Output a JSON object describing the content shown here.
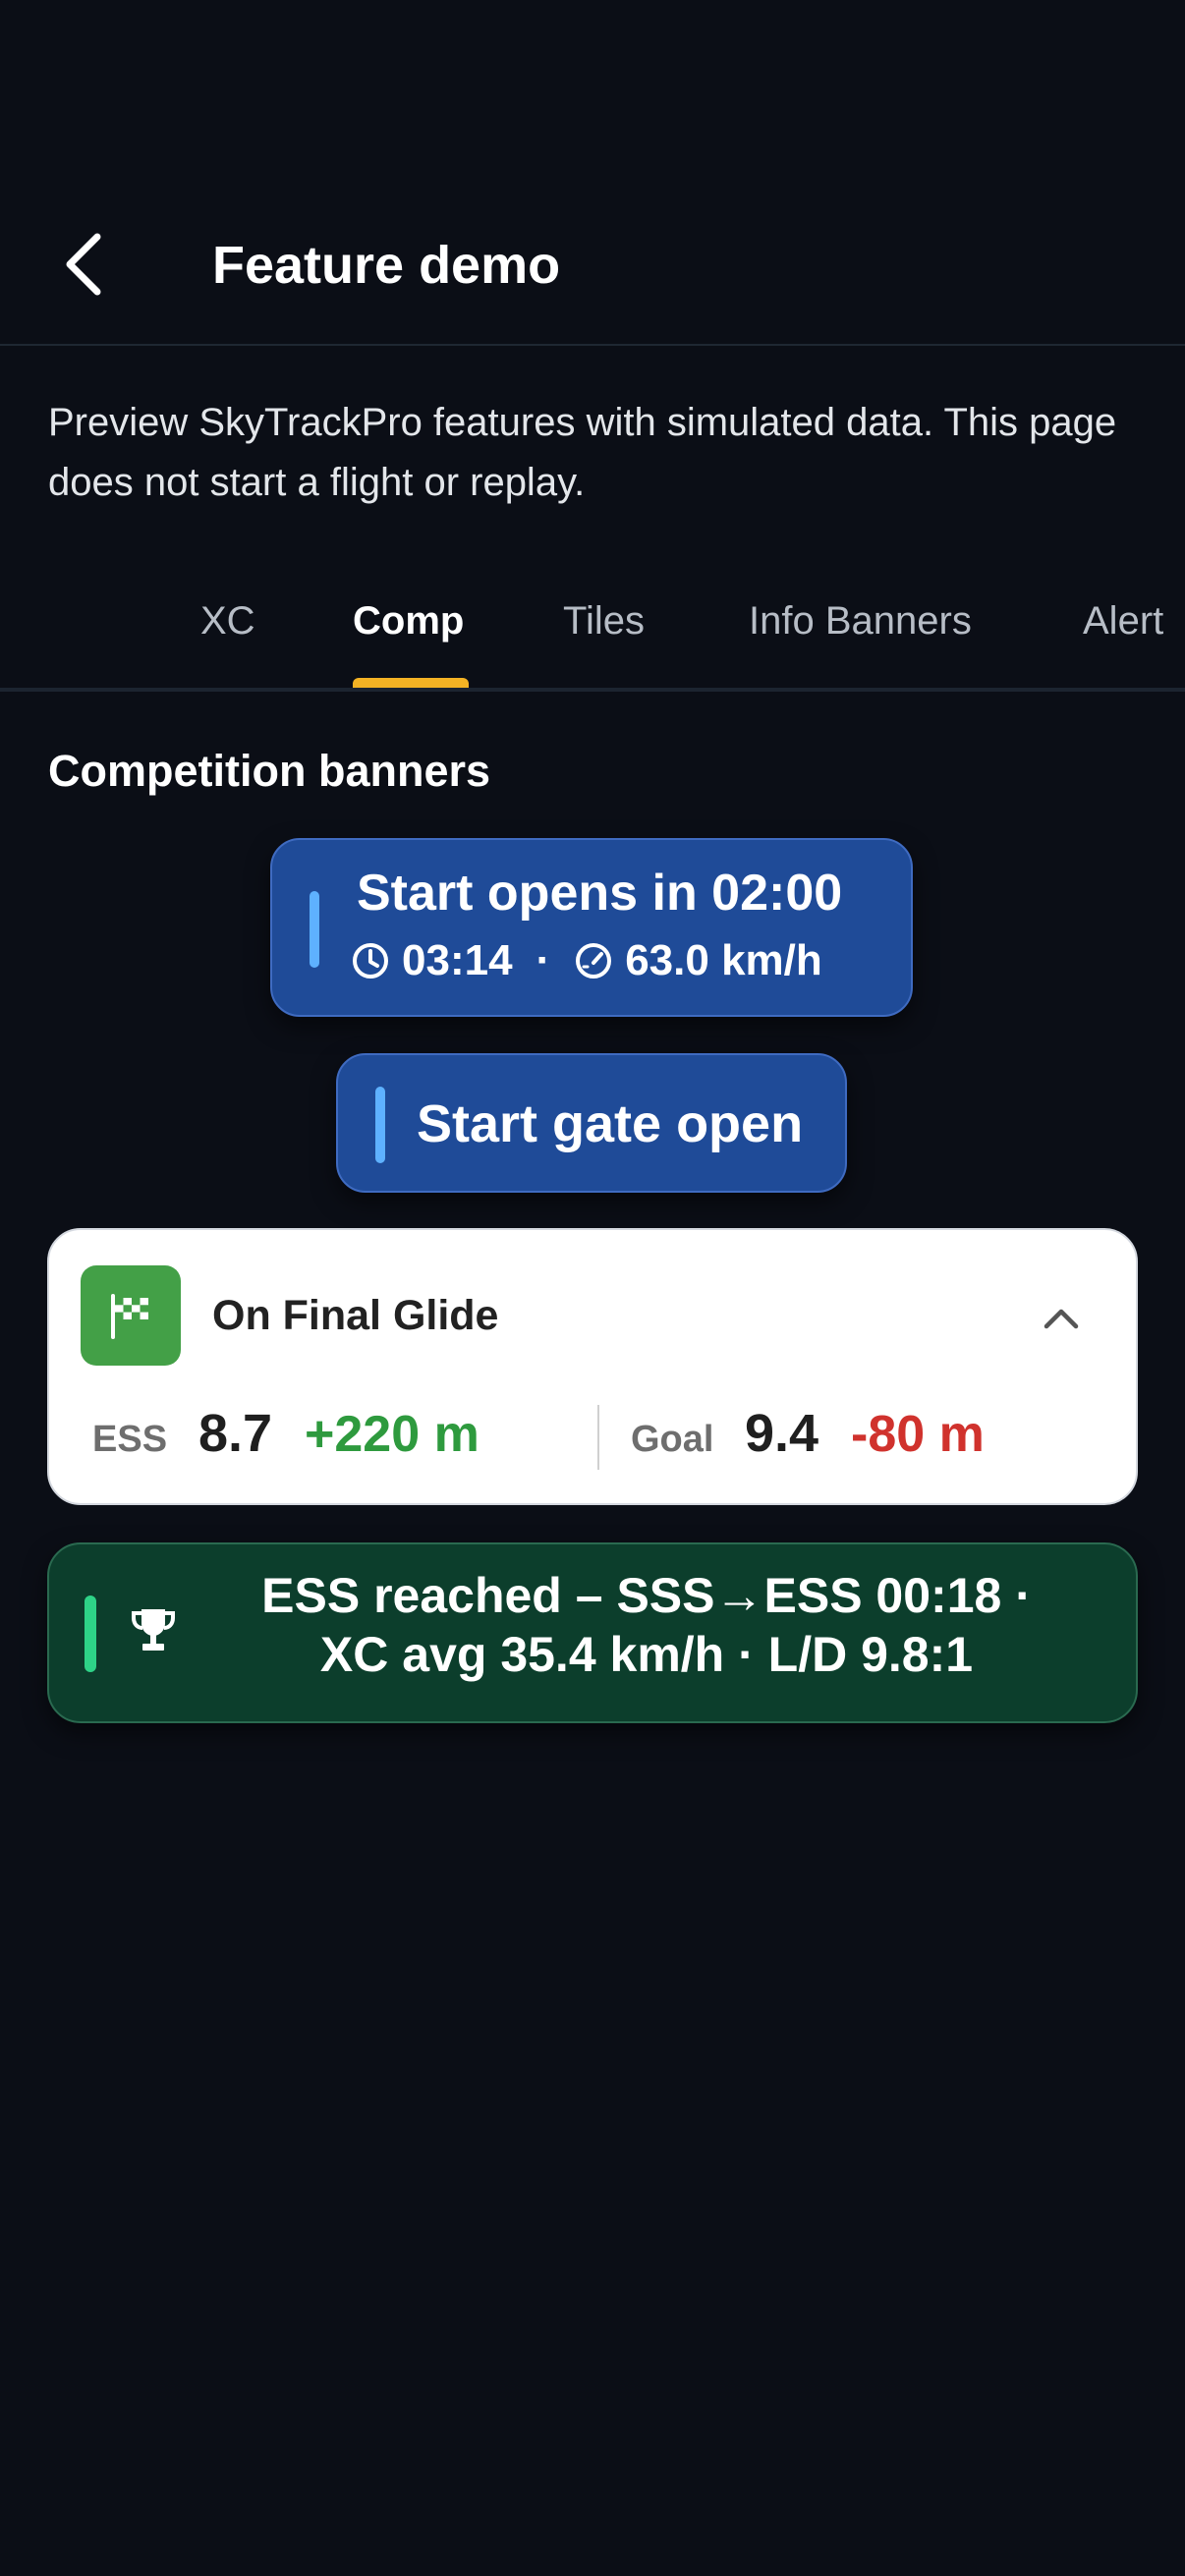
{
  "app_bar": {
    "title": "Feature demo",
    "back_icon": "chevron-left-icon"
  },
  "description": "Preview SkyTrackPro features with simulated data. This page does not start a flight or replay.",
  "tabs": [
    {
      "label": "XC",
      "active": false
    },
    {
      "label": "Comp",
      "active": true
    },
    {
      "label": "Tiles",
      "active": false
    },
    {
      "label": "Info Banners",
      "active": false
    },
    {
      "label": "Alert",
      "active": false
    }
  ],
  "section": {
    "title": "Competition banners"
  },
  "start_opens_banner": {
    "title": "Start opens in 02:00",
    "time_icon": "clock-icon",
    "time": "03:14",
    "separator": "·",
    "speed_icon": "speedometer-icon",
    "speed": "63.0 km/h"
  },
  "start_gate_banner": {
    "title": "Start gate open"
  },
  "final_glide_card": {
    "icon": "checkered-flag-icon",
    "title": "On Final Glide",
    "collapse_icon": "chevron-up-icon",
    "ess": {
      "label": "ESS",
      "value": "8.7",
      "delta": "+220 m"
    },
    "goal": {
      "label": "Goal",
      "value": "9.4",
      "delta": "-80 m"
    }
  },
  "ess_banner": {
    "icon": "trophy-icon",
    "line1": "ESS reached – SSS→ESS 00:18 ·",
    "line2": "XC avg 35.4 km/h · L/D 9.8:1"
  },
  "colors": {
    "background": "#0b0e16",
    "tab_indicator": "#f4b324",
    "comp_banner_bg": "#1f4b98",
    "comp_banner_accent": "#5eb1ff",
    "glide_icon_bg": "#43a047",
    "positive_delta": "#2e9a3e",
    "negative_delta": "#d0322d",
    "ess_banner_bg": "#0c3e2c",
    "ess_accent": "#2ed387"
  }
}
